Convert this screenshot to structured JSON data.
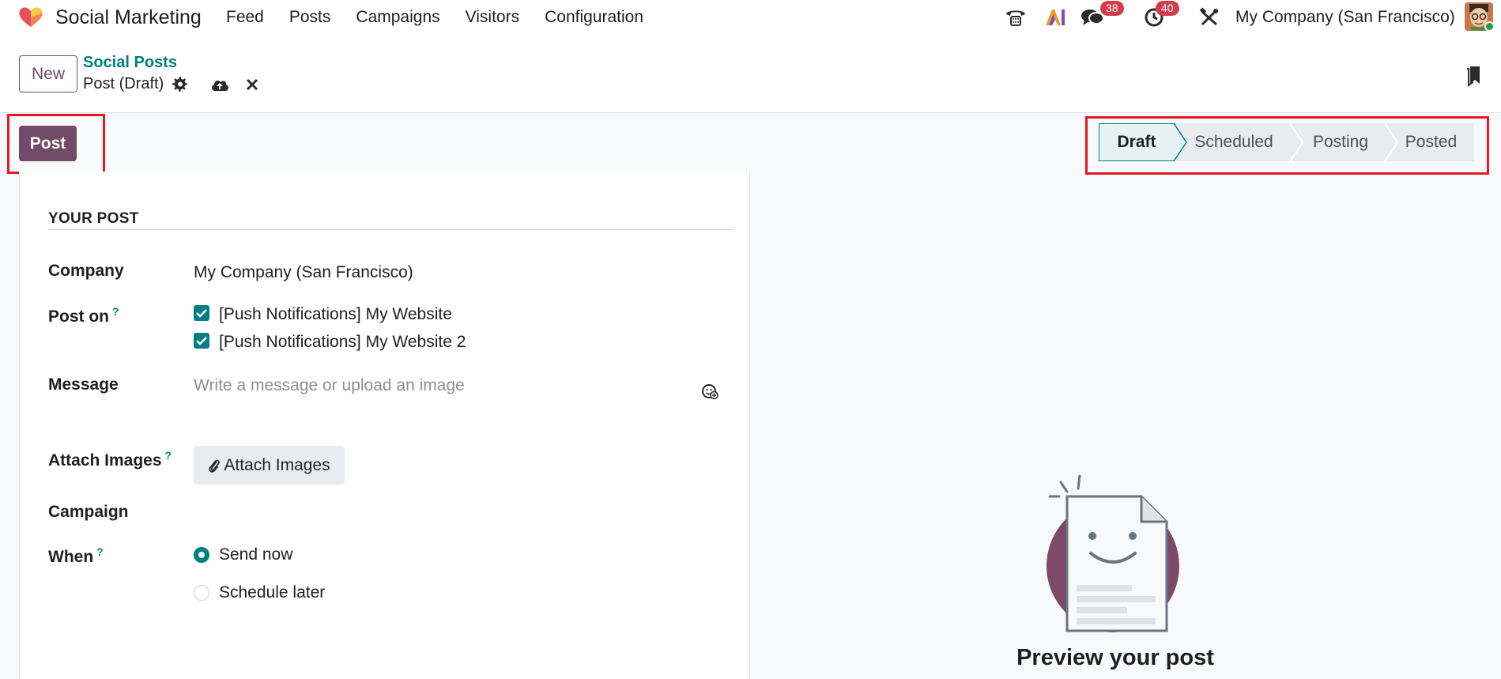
{
  "navbar": {
    "app_name": "Social Marketing",
    "app_icon": "heart-logo-icon",
    "menu": [
      "Feed",
      "Posts",
      "Campaigns",
      "Visitors",
      "Configuration"
    ],
    "messages_count": "38",
    "activities_count": "40",
    "company": "My Company (San Francisco)"
  },
  "control_panel": {
    "new_label": "New",
    "breadcrumb_parent": "Social Posts",
    "breadcrumb_current": "Post (Draft)"
  },
  "actions": {
    "post_label": "Post"
  },
  "statusbar": {
    "stages": [
      "Draft",
      "Scheduled",
      "Posting",
      "Posted"
    ],
    "active": "Draft"
  },
  "form": {
    "section_title": "YOUR POST",
    "company_label": "Company",
    "company_value": "My Company (San Francisco)",
    "post_on_label": "Post on",
    "accounts": [
      "[Push Notifications] My Website",
      "[Push Notifications] My Website 2"
    ],
    "message_label": "Message",
    "message_placeholder": "Write a message or upload an image",
    "attach_label": "Attach Images",
    "attach_button": "Attach Images",
    "campaign_label": "Campaign",
    "when_label": "When",
    "when_options": [
      "Send now",
      "Schedule later"
    ],
    "when_selected": "Send now",
    "help_mark": "?"
  },
  "preview": {
    "title": "Preview your post"
  },
  "colors": {
    "brand": "#714b67",
    "accent": "#017e84",
    "badge": "#d43b4c",
    "highlight": "#e01b24"
  }
}
